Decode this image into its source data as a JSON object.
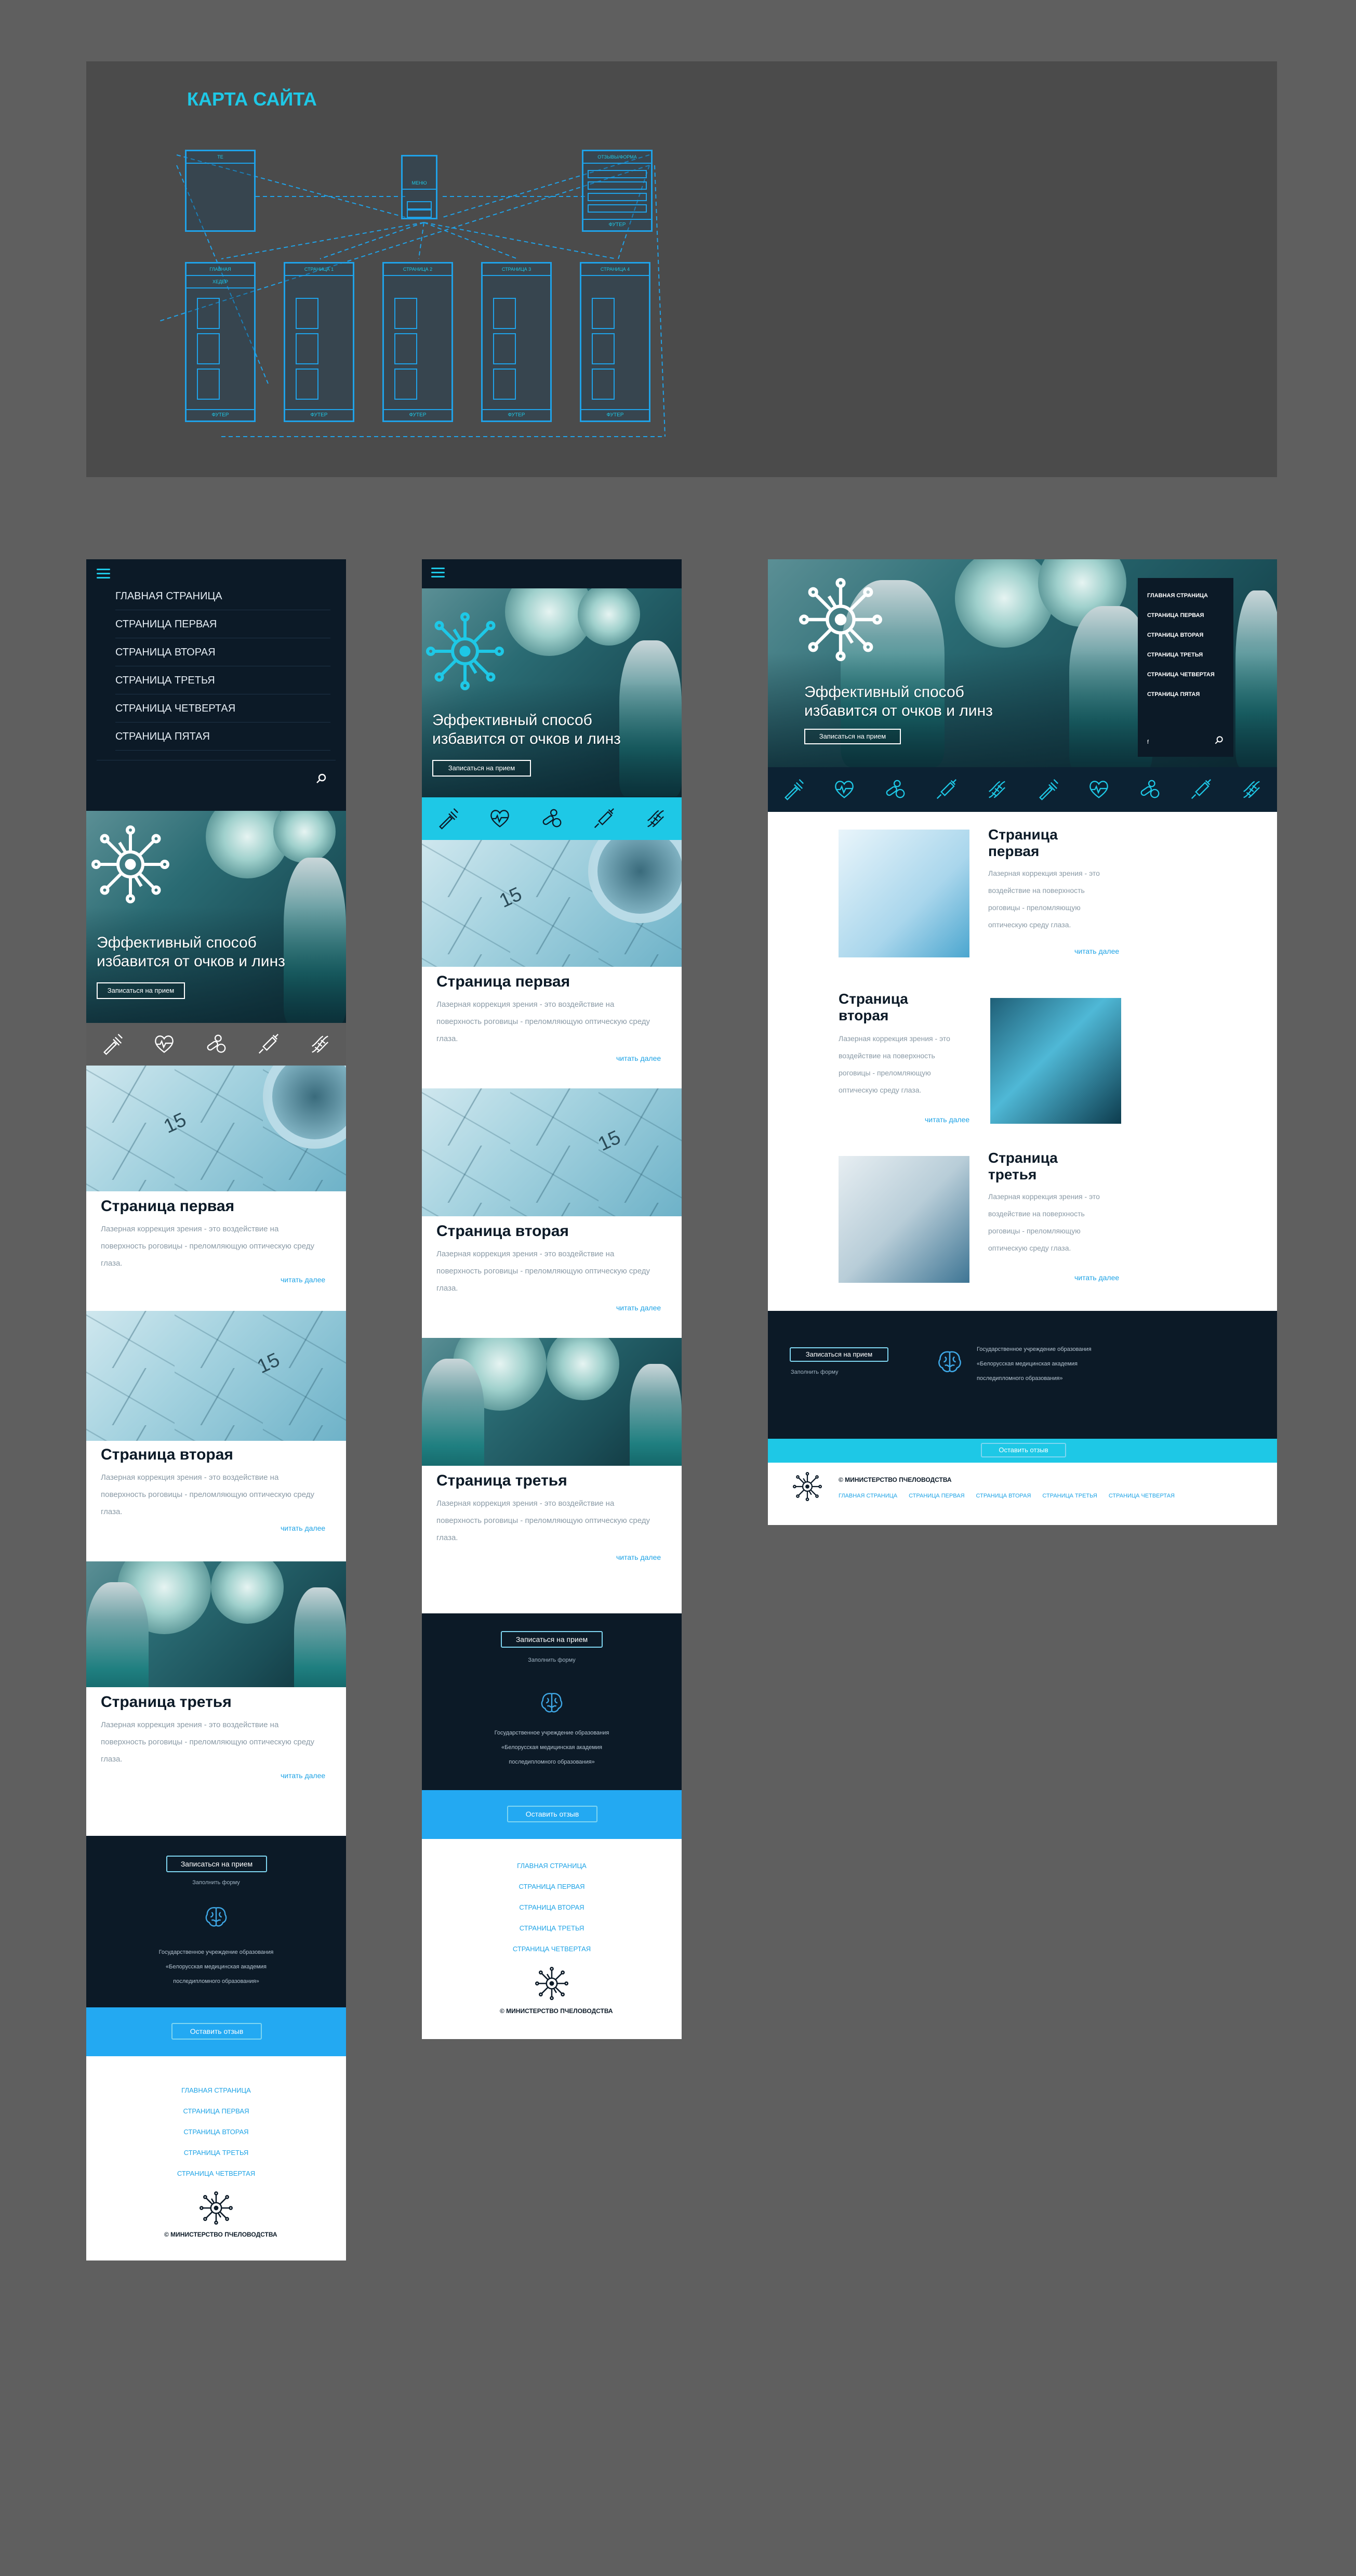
{
  "sitemap": {
    "title": "КАРТА САЙТА",
    "top_boxes": [
      {
        "label": "ТЕ"
      },
      {
        "label": "МЕНЮ"
      },
      {
        "label": "ОТЗЫВЫ/ФОРМА",
        "footer": "ФУТЕР"
      }
    ],
    "pages": [
      {
        "label": "ГЛАВНАЯ",
        "sub": "ХЕДЕР",
        "footer": "ФУТЕР"
      },
      {
        "label": "СТРАНИЦА 1",
        "footer": "ФУТЕР"
      },
      {
        "label": "СТРАНИЦА 2",
        "footer": "ФУТЕР"
      },
      {
        "label": "СТРАНИЦА 3",
        "footer": "ФУТЕР"
      },
      {
        "label": "СТРАНИЦА 4",
        "footer": "ФУТЕР"
      }
    ]
  },
  "menu": {
    "items": [
      "ГЛАВНАЯ СТРАНИЦА",
      "СТРАНИЦА ПЕРВАЯ",
      "СТРАНИЦА ВТОРАЯ",
      "СТРАНИЦА ТРЕТЬЯ",
      "СТРАНИЦА ЧЕТВЕРТАЯ",
      "СТРАНИЦА ПЯТАЯ"
    ]
  },
  "desktop_menu": {
    "items": [
      "ГЛАВНАЯ СТРАНИЦА",
      "СТРАНИЦА ПЕРВАЯ",
      "СТРАНИЦА ВТОРАЯ",
      "СТРАНИЦА ТРЕТЬЯ",
      "СТРАНИЦА ЧЕТВЕРТАЯ",
      "СТРАНИЦА ПЯТАЯ"
    ],
    "social": "f"
  },
  "hero": {
    "text_line1": "Эффективный способ",
    "text_line2": "избавится от очков и линз",
    "button": "Записаться на прием"
  },
  "cards": [
    {
      "title": "Страница первая",
      "title_l1": "Страница",
      "title_l2": "первая",
      "text_l1": "Лазерная коррекция зрения - это воздействие на",
      "text_l2": "поверхность роговицы - преломляющую оптическую среду",
      "text_l3": "глаза.",
      "more": "читать далее"
    },
    {
      "title": "Страница вторая",
      "title_l1": "Страница",
      "title_l2": "вторая",
      "text_l1": "Лазерная коррекция зрения - это воздействие на",
      "text_l2": "поверхность роговицы - преломляющую оптическую среду",
      "text_l3": "глаза.",
      "more": "читать далее"
    },
    {
      "title": "Страница третья",
      "title_l1": "Страница",
      "title_l2": "третья",
      "text_l1": "Лазерная коррекция зрения - это воздействие на",
      "text_l2": "поверхность роговицы - преломляющую оптическую среду",
      "text_l3": "глаза.",
      "more": "читать далее"
    }
  ],
  "desktop_card_text": {
    "l1": "Лазерная коррекция зрения - это",
    "l2": "воздействие на поверхность",
    "l3": "роговицы - преломляющую",
    "l4": "оптическую среду глаза."
  },
  "footer": {
    "appointment": "Записаться на прием",
    "fill_form": "Заполнить форму",
    "org_l1": "Государственное учреждение образования",
    "org_l2": "«Белорусская медицинская академия",
    "org_l3": "последипломного образования»",
    "feedback": "Оставить отзыв",
    "links": [
      "ГЛАВНАЯ СТРАНИЦА",
      "СТРАНИЦА ПЕРВАЯ",
      "СТРАНИЦА ВТОРАЯ",
      "СТРАНИЦА ТРЕТЬЯ",
      "СТРАНИЦА ЧЕТВЕРТАЯ"
    ],
    "copyright": "© МИНИСТЕРСТВО ПЧЕЛОВОДСТВА"
  },
  "colors": {
    "navy": "#0c1a27",
    "cyan": "#1ec8e6",
    "blue": "#1ea3e6",
    "bright_blue": "#23a9f2"
  }
}
